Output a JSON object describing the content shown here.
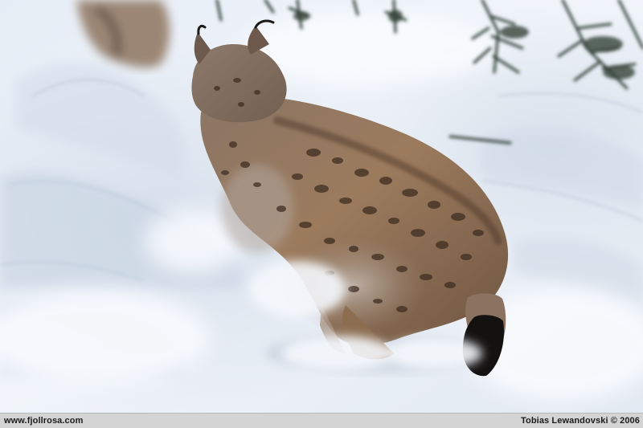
{
  "photo": {
    "subject": "lynx walking through snow"
  },
  "caption": {
    "website": "www.fjollrosa.com",
    "credit": "Tobias Lewandovski © 2006"
  }
}
